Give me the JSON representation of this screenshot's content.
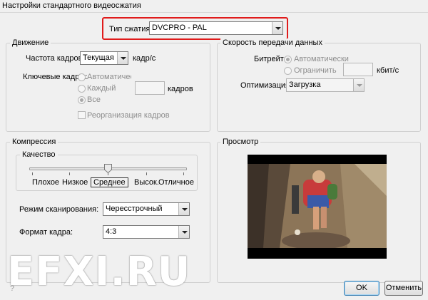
{
  "window": {
    "title": "Настройки стандартного видеосжатия"
  },
  "compression_type": {
    "label": "Тип сжатия:",
    "value": "DVCPRO - PAL"
  },
  "motion": {
    "title": "Движение",
    "frame_rate_label": "Частота кадров:",
    "frame_rate_value": "Текущая",
    "frame_rate_unit": "кадр/с",
    "keyframes_label": "Ключевые кадры:",
    "keyframe_auto": "Автоматически",
    "keyframe_every": "Каждый",
    "keyframe_every_unit": "кадров",
    "keyframe_all": "Все",
    "reorder_label": "Реорганизация кадров"
  },
  "data_rate": {
    "title": "Скорость передачи данных",
    "bitrate_label": "Битрейт:",
    "auto_label": "Автоматически",
    "limit_label": "Ограничить",
    "unit": "кбит/с",
    "optimize_label": "Оптимизация:",
    "optimize_value": "Загрузка"
  },
  "compression": {
    "title": "Компрессия",
    "quality_title": "Качество",
    "quality_levels": [
      "Плохое",
      "Низкое",
      "Среднее",
      "Высок.",
      "Отличное"
    ],
    "quality_selected_index": 2,
    "scan_label": "Режим сканирования:",
    "scan_value": "Чересстрочный",
    "aspect_label": "Формат кадра:",
    "aspect_value": "4:3"
  },
  "preview": {
    "title": "Просмотр"
  },
  "buttons": {
    "help": "?",
    "ok": "OK",
    "cancel": "Отменить"
  },
  "watermark": "EFXI.RU",
  "colors": {
    "highlight": "#e01b1b",
    "dialog_bg": "#f0f0f0"
  }
}
